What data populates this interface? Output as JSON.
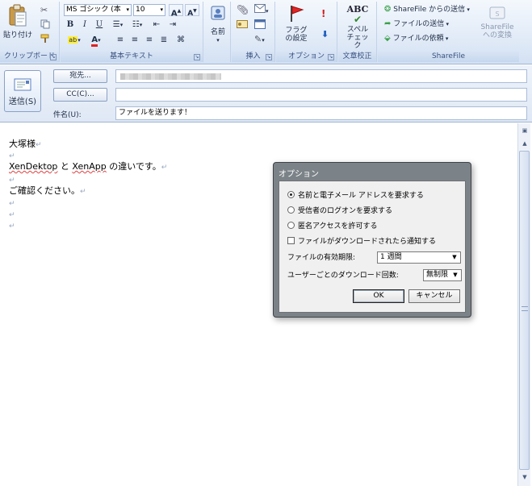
{
  "ribbon": {
    "clipboard": {
      "paste_label": "貼り付け",
      "group_label": "クリップボード"
    },
    "basic_text": {
      "font_name": "MS ゴシック (本",
      "font_size": "10",
      "bold": "B",
      "italic": "I",
      "underline": "U",
      "grow_font": "A",
      "shrink_font": "A",
      "font_color": "A",
      "group_label": "基本テキスト"
    },
    "names": {
      "label": "名前"
    },
    "insert": {
      "group_label": "挿入"
    },
    "options": {
      "flag_label": "フラグの設定",
      "group_label": "オプション"
    },
    "proofing": {
      "abc": "ABC",
      "spell_label": "スペルチェック",
      "group_label": "文章校正"
    },
    "sharefile": {
      "send_from": "ShareFile からの送信",
      "send_file": "ファイルの送信",
      "request_file": "ファイルの依頼",
      "convert": "ShareFile への変換",
      "group_label": "ShareFile"
    }
  },
  "header": {
    "send_label": "送信(S)",
    "to_button": "宛先...",
    "cc_button": "CC(C)...",
    "subject_label": "件名(U):",
    "to_value": "",
    "cc_value": "",
    "subject_value": "ファイルを送ります！"
  },
  "body": {
    "greeting": "大塚様",
    "line_word1": "XenDektop",
    "line_mid": " と ",
    "line_word2": "XenApp",
    "line_rest": " の違いです。",
    "confirm": "ご確認ください。",
    "para_mark": "↵"
  },
  "dialog": {
    "title": "オプション",
    "radio_name_email": "名前と電子メール アドレスを要求する",
    "radio_logon": "受信者のログオンを要求する",
    "radio_anonymous": "匿名アクセスを許可する",
    "check_notify": "ファイルがダウンロードされたら通知する",
    "expiry_label": "ファイルの有効期限:",
    "expiry_value": "1 週間",
    "download_label": "ユーザーごとのダウンロード回数:",
    "download_value": "無制限",
    "ok": "OK",
    "cancel": "キャンセル"
  },
  "colors": {
    "accent": "#c6d7ee",
    "dialog_frame": "#7c8388"
  },
  "icons": [
    "paste-icon",
    "cut-icon",
    "copy-icon",
    "format-painter-icon",
    "address-book-icon",
    "attach-icon",
    "flag-icon",
    "importance-high-icon",
    "importance-low-icon",
    "spellcheck-icon",
    "sharefile-icon",
    "send-icon"
  ]
}
